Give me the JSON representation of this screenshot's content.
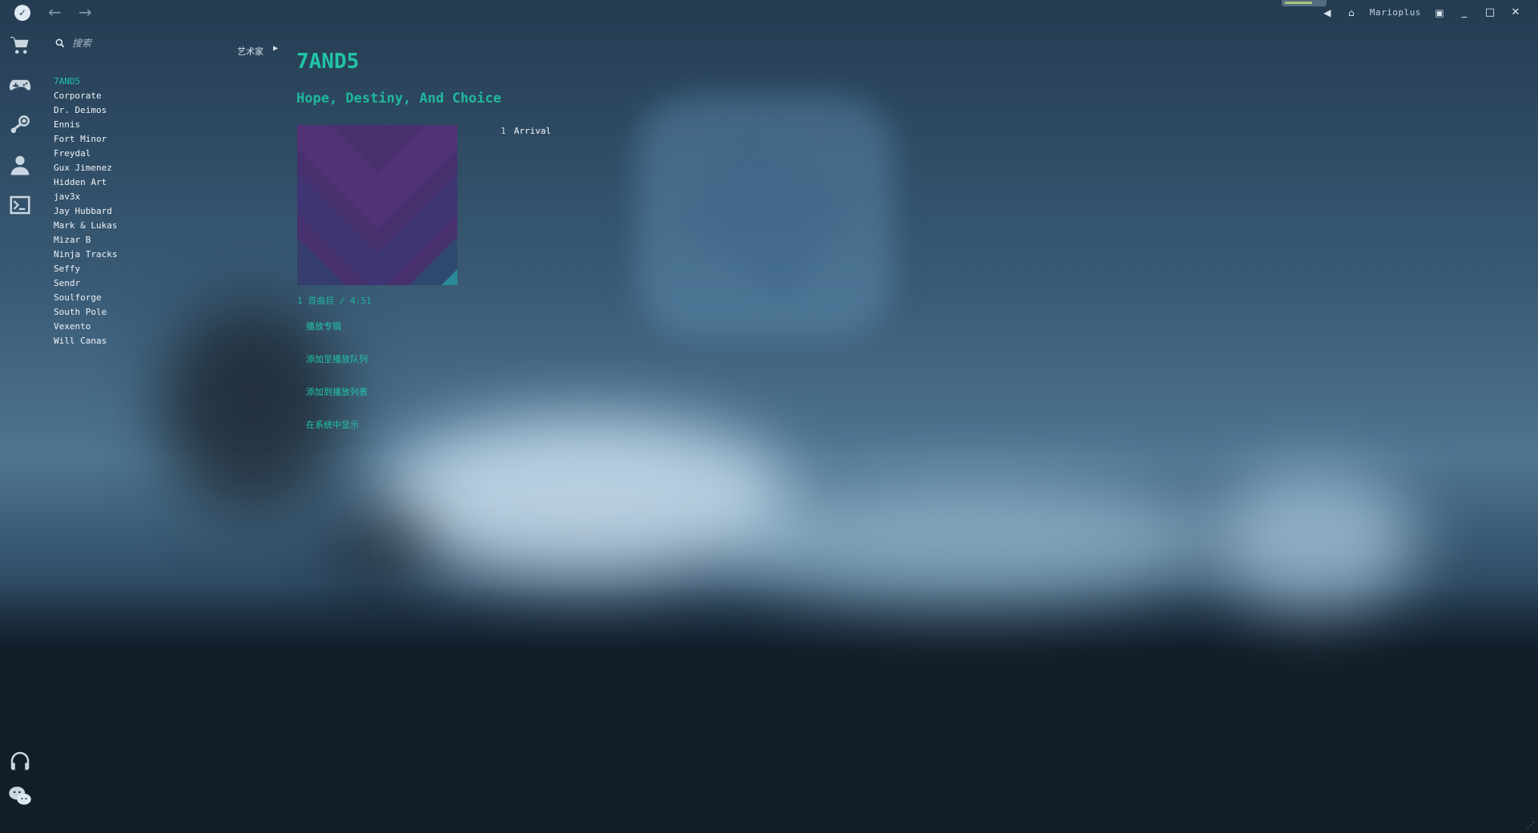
{
  "window": {
    "username": "Marioplus",
    "progress_fraction": 0.7,
    "controls": {
      "minimize": "_",
      "maximize": "□",
      "close": "✕"
    }
  },
  "nav": {
    "back": "←",
    "forward": "→"
  },
  "rail": {
    "top_icons": [
      "cart-icon",
      "gamepad-icon",
      "steam-icon",
      "profile-icon",
      "terminal-icon"
    ],
    "bottom_icons": [
      "headphones-icon",
      "wechat-icon"
    ]
  },
  "search": {
    "placeholder": "搜索"
  },
  "breadcrumb": {
    "label": "艺术家"
  },
  "artists": [
    "7AND5",
    "Corporate",
    "Dr. Deimos",
    "Ennis",
    "Fort Minor",
    "Freydal",
    "Gux Jimenez",
    "Hidden Art",
    "jav3x",
    "Jay Hubbard",
    "Mark & Lukas",
    "Mizar B",
    "Ninja Tracks",
    "Seffy",
    "Sendr",
    "Soulforge",
    "South Pole",
    "Vexento",
    "Will Canas"
  ],
  "selected_artist_index": 0,
  "main": {
    "artist_name": "7AND5",
    "album_title": "Hope, Destiny, And Choice",
    "album_meta": "1 首曲目 / 4:51",
    "tracks": [
      {
        "number": "1",
        "title": "Arrival"
      }
    ],
    "actions": {
      "play_album": "播放专辑",
      "add_to_queue": "添加至播放队列",
      "add_to_playlist": "添加到播放列表",
      "show_in_system": "在系统中显示"
    }
  },
  "colors": {
    "accent": "#1fc7a8",
    "text": "#eef3f7",
    "cover_purple": "#4b2a6e"
  }
}
